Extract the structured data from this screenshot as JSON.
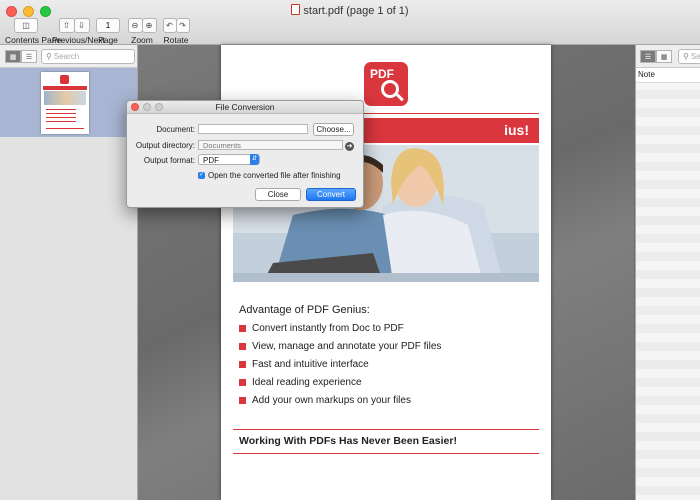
{
  "window": {
    "title": "start.pdf (page 1 of 1)",
    "traffic_lights": [
      "#fc5f57",
      "#fdbc2e",
      "#28c840"
    ]
  },
  "toolbar": {
    "contents_pane_label": "Contents Pane",
    "prev_next_label": "Previous/Next",
    "page_label": "Page",
    "page_value": "1",
    "zoom_label": "Zoom",
    "rotate_label": "Rotate"
  },
  "sidebar": {
    "search_placeholder": "Search"
  },
  "notes_pane": {
    "header_label": "Note",
    "search_placeholder": "Sea"
  },
  "pdf_page": {
    "logo_text": "PDF",
    "banner_text": "ius!",
    "advantage_heading": "Advantage of PDF Genius:",
    "features": [
      "Convert instantly from Doc to PDF",
      "View, manage and annotate your PDF files",
      "Fast and intuitive interface",
      "Ideal reading experience",
      "Add your own markups on your files"
    ],
    "footer": "Working With PDFs Has Never Been Easier!",
    "accent_color": "#d9363e"
  },
  "dialog": {
    "title": "File Conversion",
    "document_label": "Document:",
    "document_value": "",
    "choose_button": "Choose...",
    "output_directory_label": "Output directory:",
    "output_directory_value": "Documents",
    "output_format_label": "Output format:",
    "output_format_value": "PDF",
    "open_after_label": "Open the converted file after finishing",
    "open_after_checked": true,
    "close_button": "Close",
    "convert_button": "Convert"
  }
}
